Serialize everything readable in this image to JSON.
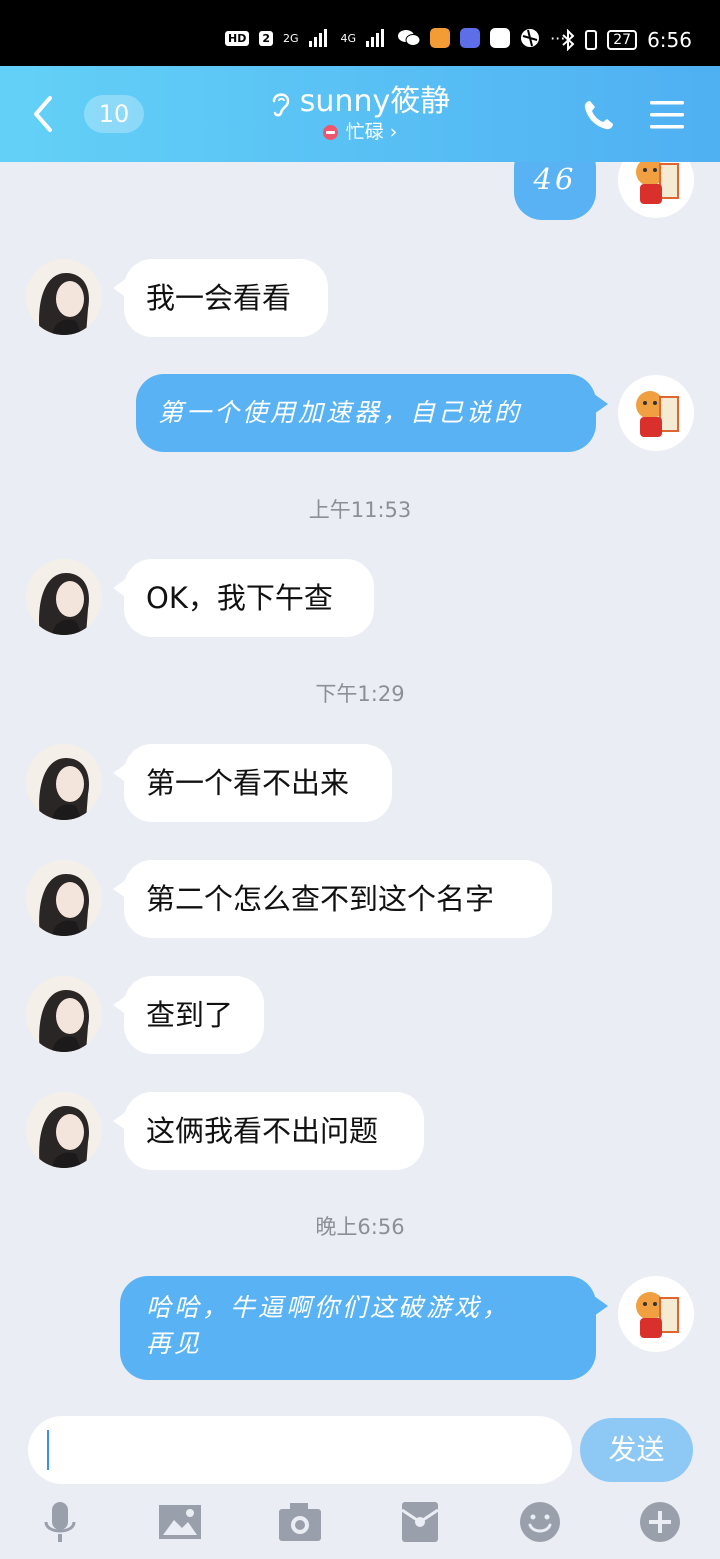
{
  "status_bar": {
    "network_chip": "HD",
    "sim": "2",
    "signal1": "2G",
    "signal2": "4G",
    "more": "···",
    "battery": "27",
    "time": "6:56"
  },
  "header": {
    "unread_count": "10",
    "title": "sunny筱静",
    "status": "忙碌 ›"
  },
  "messages": [
    {
      "dir": "out",
      "text": "46"
    },
    {
      "dir": "in",
      "text": "我一会看看"
    },
    {
      "dir": "out",
      "text": "第一个使用加速器，自己说的"
    },
    {
      "dir": "ts",
      "text": "上午11:53"
    },
    {
      "dir": "in",
      "text": "OK，我下午查"
    },
    {
      "dir": "ts",
      "text": "下午1:29"
    },
    {
      "dir": "in",
      "text": "第一个看不出来"
    },
    {
      "dir": "in",
      "text": "第二个怎么查不到这个名字"
    },
    {
      "dir": "in",
      "text": "查到了"
    },
    {
      "dir": "in",
      "text": "这俩我看不出问题"
    },
    {
      "dir": "ts",
      "text": "晚上6:56"
    },
    {
      "dir": "out",
      "text_line1": "哈哈，牛逼啊你们这破游戏，",
      "text_line2": "再见"
    }
  ],
  "input": {
    "value": "",
    "send_label": "发送"
  },
  "toolbar": [
    "microphone-icon",
    "image-icon",
    "camera-icon",
    "red-packet-icon",
    "emoji-icon",
    "plus-icon"
  ],
  "colors": {
    "header_start": "#63d1f7",
    "header_end": "#4fb0f2",
    "outgoing_bubble": "#58b2f4",
    "incoming_bubble": "#ffffff",
    "background": "#eaedf4",
    "send_button": "#8dc9f4",
    "busy_status": "#f0566b"
  }
}
